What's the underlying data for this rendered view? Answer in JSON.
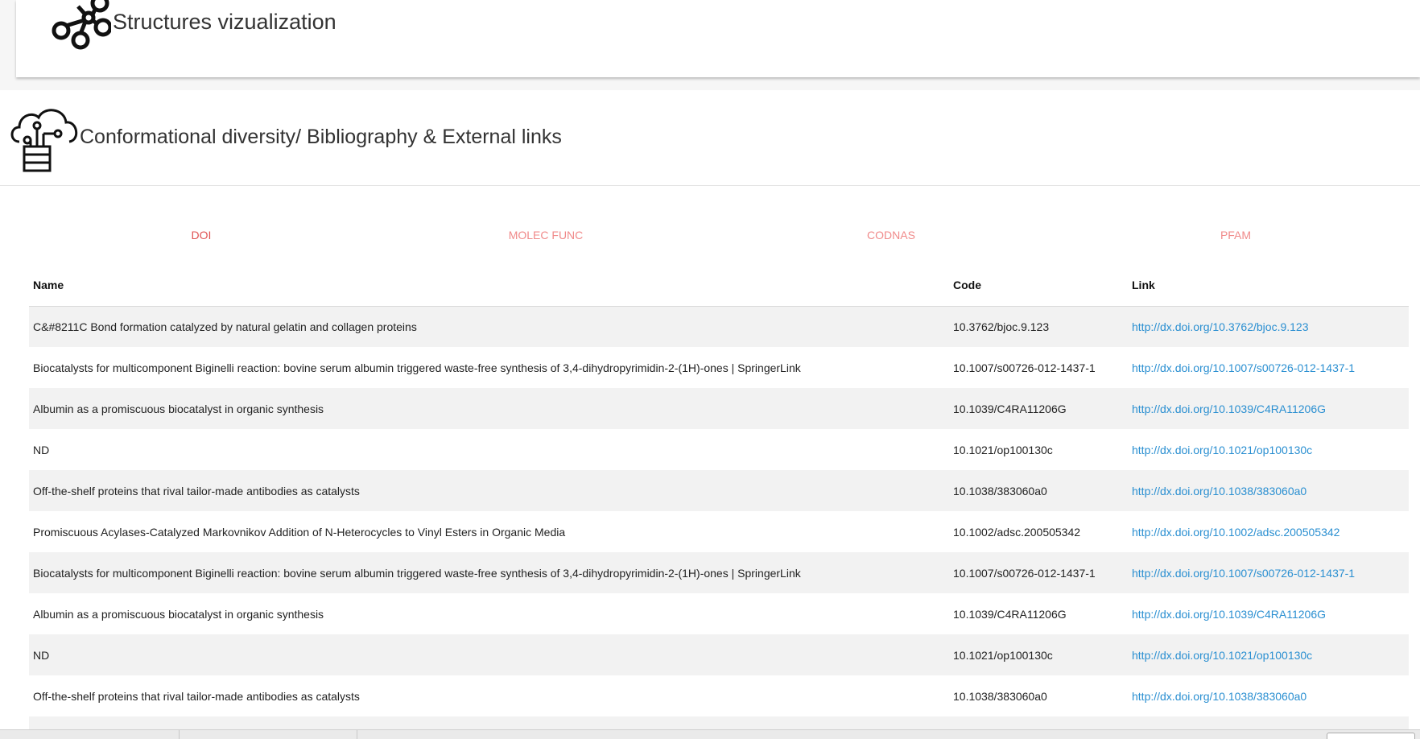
{
  "structures_card": {
    "title": "Structures vizualization",
    "icon": "molecule-network-icon"
  },
  "bibliography_panel": {
    "title": "Conformational diversity/ Bibliography & External links",
    "icon": "cloud-server-icon",
    "tabs": [
      {
        "label": "DOI",
        "active": true
      },
      {
        "label": "MOLEC FUNC",
        "active": false
      },
      {
        "label": "CODNAS",
        "active": false
      },
      {
        "label": "PFAM",
        "active": false
      }
    ],
    "table": {
      "headers": {
        "name": "Name",
        "code": "Code",
        "link": "Link"
      },
      "rows": [
        {
          "name": "C&#8211C Bond formation catalyzed by natural gelatin and collagen proteins",
          "code": "10.3762/bjoc.9.123",
          "link": "http://dx.doi.org/10.3762/bjoc.9.123"
        },
        {
          "name": "Biocatalysts for multicomponent Biginelli reaction: bovine serum albumin triggered waste-free synthesis of 3,4-dihydropyrimidin-2-(1H)-ones | SpringerLink",
          "code": "10.1007/s00726-012-1437-1",
          "link": "http://dx.doi.org/10.1007/s00726-012-1437-1"
        },
        {
          "name": "Albumin as a promiscuous biocatalyst in organic synthesis",
          "code": "10.1039/C4RA11206G",
          "link": "http://dx.doi.org/10.1039/C4RA11206G"
        },
        {
          "name": "ND",
          "code": "10.1021/op100130c",
          "link": "http://dx.doi.org/10.1021/op100130c"
        },
        {
          "name": "Off-the-shelf proteins that rival tailor-made antibodies as catalysts",
          "code": "10.1038/383060a0",
          "link": "http://dx.doi.org/10.1038/383060a0"
        },
        {
          "name": "Promiscuous Acylases-Catalyzed Markovnikov Addition of N-Heterocycles to Vinyl Esters in Organic Media",
          "code": "10.1002/adsc.200505342",
          "link": "http://dx.doi.org/10.1002/adsc.200505342"
        },
        {
          "name": "Biocatalysts for multicomponent Biginelli reaction: bovine serum albumin triggered waste-free synthesis of 3,4-dihydropyrimidin-2-(1H)-ones | SpringerLink",
          "code": "10.1007/s00726-012-1437-1",
          "link": "http://dx.doi.org/10.1007/s00726-012-1437-1"
        },
        {
          "name": "Albumin as a promiscuous biocatalyst in organic synthesis",
          "code": "10.1039/C4RA11206G",
          "link": "http://dx.doi.org/10.1039/C4RA11206G"
        },
        {
          "name": "ND",
          "code": "10.1021/op100130c",
          "link": "http://dx.doi.org/10.1021/op100130c"
        },
        {
          "name": "Off-the-shelf proteins that rival tailor-made antibodies as catalysts",
          "code": "10.1038/383060a0",
          "link": "http://dx.doi.org/10.1038/383060a0"
        }
      ]
    }
  },
  "colors": {
    "tab_active": "#e05555",
    "tab_inactive": "#f08a8a",
    "link": "#2a8fd1",
    "row_stripe": "#f2f2f2"
  }
}
